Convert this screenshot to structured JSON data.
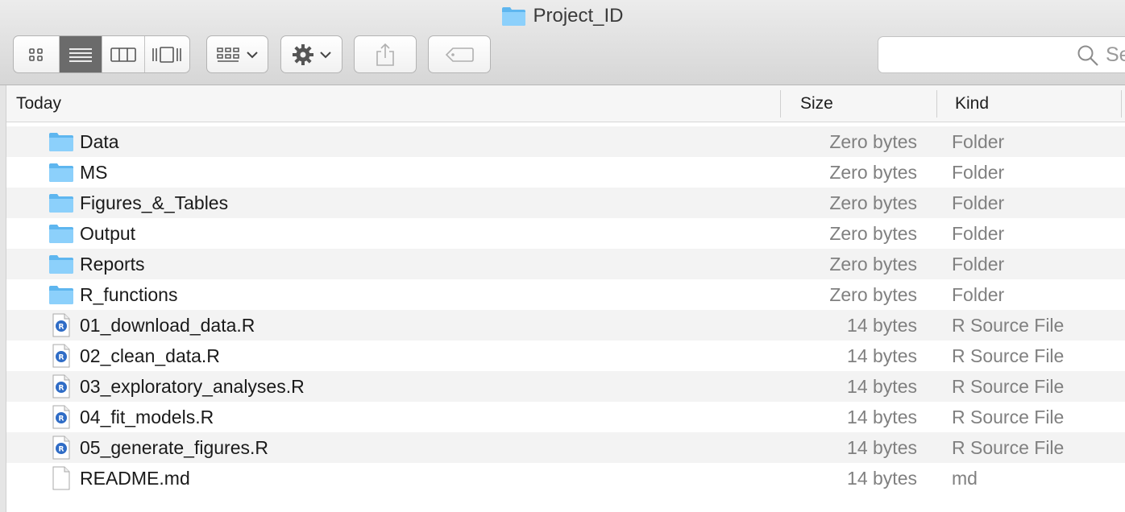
{
  "window": {
    "title": "Project_ID",
    "title_icon": "folder-icon"
  },
  "toolbar": {
    "view_buttons": [
      {
        "name": "icon-view",
        "icon": "grid-icon",
        "active": false
      },
      {
        "name": "list-view",
        "icon": "list-icon",
        "active": true
      },
      {
        "name": "column-view",
        "icon": "columns-icon",
        "active": false
      },
      {
        "name": "cover-flow-view",
        "icon": "cover-flow-icon",
        "active": false
      }
    ],
    "arrange_icon": "arrange-grid-icon",
    "action_icon": "gear-icon",
    "share_icon": "share-icon",
    "tag_icon": "tag-icon"
  },
  "search": {
    "placeholder": "Search"
  },
  "columns": {
    "name": "Today",
    "size": "Size",
    "kind": "Kind"
  },
  "files": [
    {
      "name": "Data",
      "size": "Zero bytes",
      "kind": "Folder",
      "icon": "folder-icon"
    },
    {
      "name": "MS",
      "size": "Zero bytes",
      "kind": "Folder",
      "icon": "folder-icon"
    },
    {
      "name": "Figures_&_Tables",
      "size": "Zero bytes",
      "kind": "Folder",
      "icon": "folder-icon"
    },
    {
      "name": "Output",
      "size": "Zero bytes",
      "kind": "Folder",
      "icon": "folder-icon"
    },
    {
      "name": "Reports",
      "size": "Zero bytes",
      "kind": "Folder",
      "icon": "folder-icon"
    },
    {
      "name": "R_functions",
      "size": "Zero bytes",
      "kind": "Folder",
      "icon": "folder-icon"
    },
    {
      "name": "01_download_data.R",
      "size": "14 bytes",
      "kind": "R Source File",
      "icon": "r-file-icon"
    },
    {
      "name": "02_clean_data.R",
      "size": "14 bytes",
      "kind": "R Source File",
      "icon": "r-file-icon"
    },
    {
      "name": "03_exploratory_analyses.R",
      "size": "14 bytes",
      "kind": "R Source File",
      "icon": "r-file-icon"
    },
    {
      "name": "04_fit_models.R",
      "size": "14 bytes",
      "kind": "R Source File",
      "icon": "r-file-icon"
    },
    {
      "name": "05_generate_figures.R",
      "size": "14 bytes",
      "kind": "R Source File",
      "icon": "r-file-icon"
    },
    {
      "name": "README.md",
      "size": "14 bytes",
      "kind": "md",
      "icon": "document-icon"
    }
  ],
  "colors": {
    "folder": "#6ec1f4",
    "r_badge": "#2f6cc6",
    "row_alt": "#f3f3f3",
    "secondary_text": "#808080"
  }
}
